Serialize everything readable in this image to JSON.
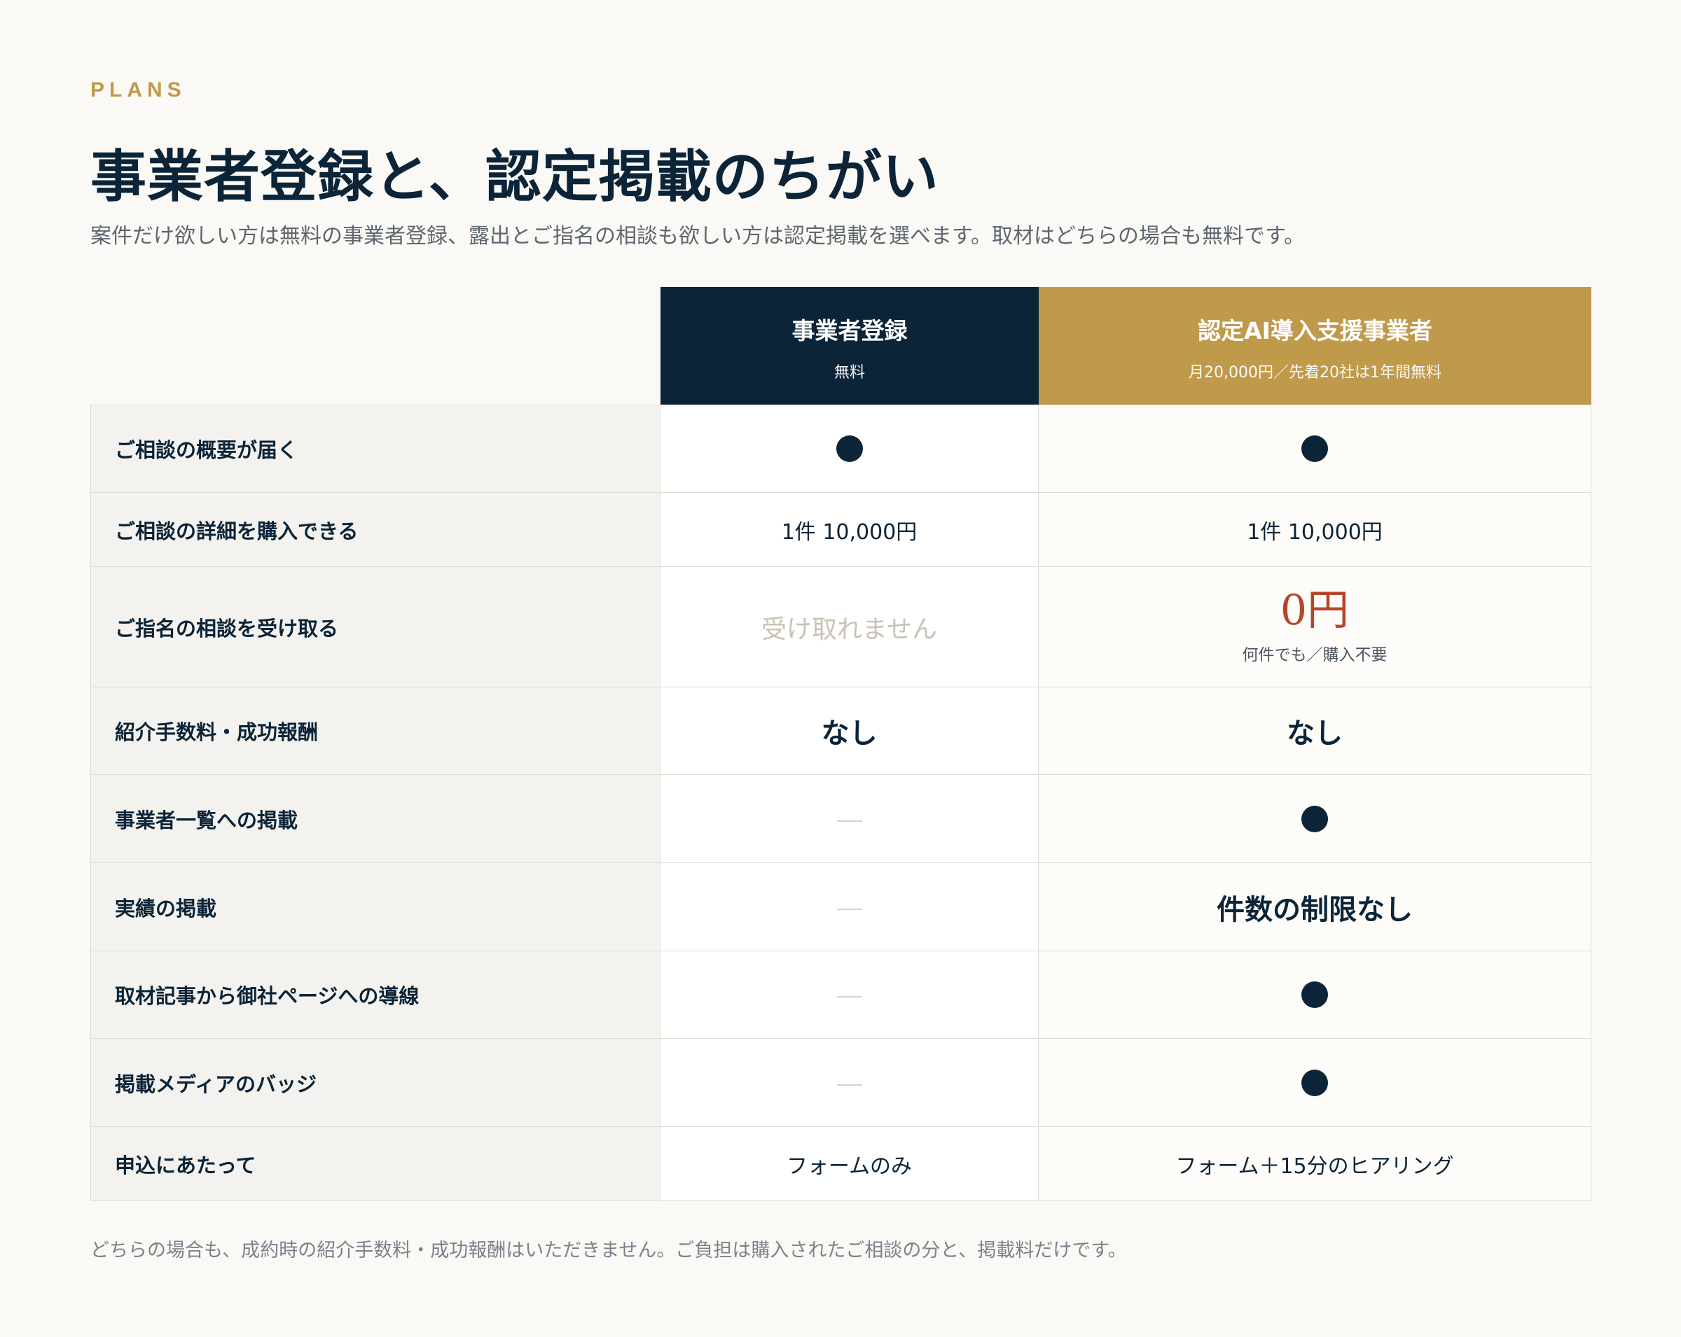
{
  "header": {
    "eyebrow": "PLANS",
    "title": "事業者登録と、認定掲載のちがい",
    "lead": "案件だけ欲しい方は無料の事業者登録、露出とご指名の相談も欲しい方は認定掲載を選べます。取材はどちらの場合も無料です。"
  },
  "plans": [
    {
      "name": "事業者登録",
      "price": "無料",
      "color": "#0c2438"
    },
    {
      "name": "認定AI導入支援事業者",
      "price": "月20,000円／先着20社は1年間無料",
      "color": "#c09a4b"
    }
  ],
  "rows": [
    {
      "label": "ご相談の概要が届く",
      "free": {
        "type": "dot"
      },
      "cert": {
        "type": "dot"
      }
    },
    {
      "label": "ご相談の詳細を購入できる",
      "free": {
        "type": "text",
        "text": "1件 10,000円"
      },
      "cert": {
        "type": "text",
        "text": "1件 10,000円"
      }
    },
    {
      "label": "ご指名の相談を受け取る",
      "free": {
        "type": "muted",
        "text": "受け取れません"
      },
      "cert": {
        "type": "price",
        "text": "0円",
        "note": "何件でも／購入不要"
      }
    },
    {
      "label": "紹介手数料・成功報酬",
      "free": {
        "type": "big",
        "text": "なし"
      },
      "cert": {
        "type": "big",
        "text": "なし"
      }
    },
    {
      "label": "事業者一覧への掲載",
      "free": {
        "type": "dash"
      },
      "cert": {
        "type": "dot"
      }
    },
    {
      "label": "実績の掲載",
      "free": {
        "type": "dash"
      },
      "cert": {
        "type": "big",
        "text": "件数の制限なし"
      }
    },
    {
      "label": "取材記事から御社ページへの導線",
      "free": {
        "type": "dash"
      },
      "cert": {
        "type": "dot"
      }
    },
    {
      "label": "掲載メディアのバッジ",
      "free": {
        "type": "dash"
      },
      "cert": {
        "type": "dot"
      }
    },
    {
      "label": "申込にあたって",
      "free": {
        "type": "text",
        "text": "フォームのみ"
      },
      "cert": {
        "type": "text",
        "text": "フォーム＋15分のヒアリング"
      }
    }
  ],
  "footnote": "どちらの場合も、成約時の紹介手数料・成功報酬はいただきません。ご負担は購入されたご相談の分と、掲載料だけです。",
  "colors": {
    "navy": "#0c2438",
    "gold": "#c09a4b",
    "accent_red": "#b8442a",
    "background": "#faf9f5"
  }
}
